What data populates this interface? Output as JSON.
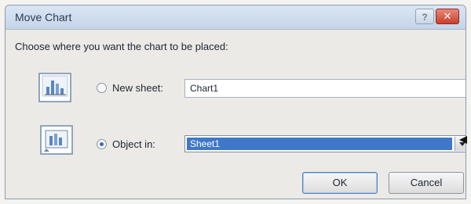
{
  "dialog": {
    "title": "Move Chart",
    "help_label": "?",
    "close_label": "✕",
    "prompt": "Choose where you want the chart to be placed:"
  },
  "options": {
    "new_sheet": {
      "label": "New sheet:",
      "value": "Chart1",
      "selected": false
    },
    "object_in": {
      "label": "Object in:",
      "value": "Sheet1",
      "selected": true
    }
  },
  "buttons": {
    "ok": "OK",
    "cancel": "Cancel"
  },
  "colors": {
    "selection": "#3f78c8",
    "close_button": "#c7402e",
    "title_bar": "#c4d4e8"
  },
  "icons": {
    "new_sheet": "chart-sheet-icon",
    "object_in": "embedded-chart-icon",
    "dropdown": "chevron-down-icon",
    "pointer": "arrow-pointer-icon"
  }
}
